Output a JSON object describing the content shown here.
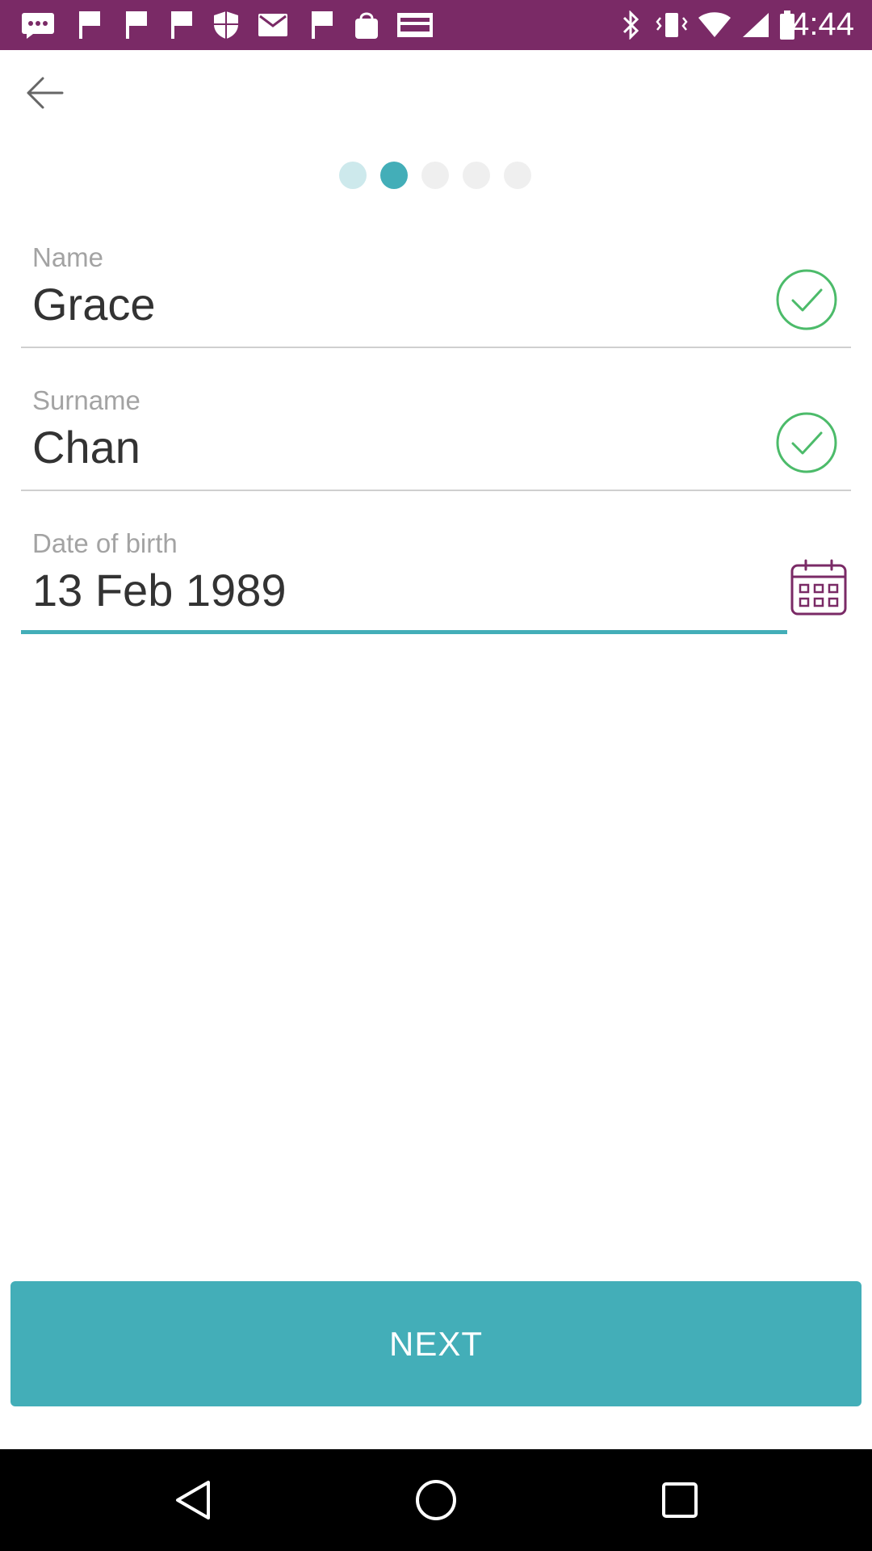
{
  "status_bar": {
    "time": "4:44",
    "background": "#7a2a66",
    "icons": [
      "message-icon",
      "flag-icon",
      "flag-icon",
      "flag-icon",
      "shield-icon",
      "email-icon",
      "flag-icon",
      "shopping-bag-icon",
      "espn-dallas-icon",
      "bluetooth-icon",
      "vibrate-icon",
      "wifi-icon",
      "signal-icon",
      "battery-icon"
    ]
  },
  "progress": {
    "total_steps": 5,
    "current_step": 2
  },
  "form": {
    "name": {
      "label": "Name",
      "value": "Grace"
    },
    "surname": {
      "label": "Surname",
      "value": "Chan"
    },
    "dob": {
      "label": "Date of birth",
      "value": "13 Feb 1989"
    }
  },
  "next_button": {
    "label": "NEXT"
  },
  "colors": {
    "accent": "#43aeb8",
    "check_green": "#4cbb6a",
    "calendar_purple": "#7a2a66",
    "dot_active": "#43aeb8",
    "dot_done": "#cde9ec",
    "dot_inactive": "#efefef"
  }
}
